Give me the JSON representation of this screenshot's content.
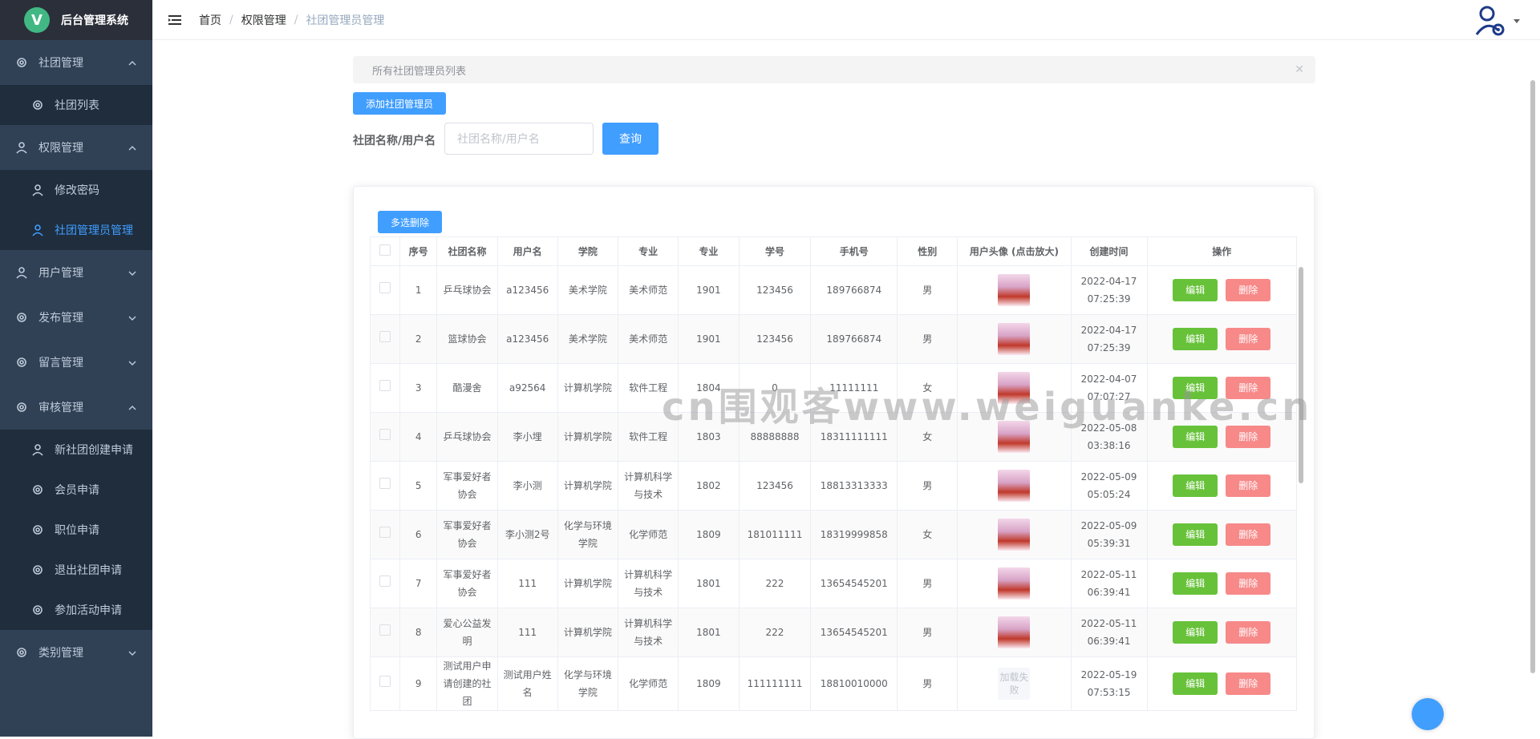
{
  "app": {
    "title": "后台管理系统",
    "logo_letter": "V"
  },
  "sidebar": {
    "groups": [
      {
        "label": "社团管理",
        "expanded": true,
        "items": [
          {
            "label": "社团列表"
          }
        ]
      },
      {
        "label": "权限管理",
        "expanded": true,
        "items": [
          {
            "label": "修改密码"
          },
          {
            "label": "社团管理员管理",
            "active": true
          }
        ]
      },
      {
        "label": "用户管理",
        "expanded": false,
        "items": []
      },
      {
        "label": "发布管理",
        "expanded": false,
        "items": []
      },
      {
        "label": "留言管理",
        "expanded": false,
        "items": []
      },
      {
        "label": "审核管理",
        "expanded": true,
        "items": [
          {
            "label": "新社团创建申请"
          },
          {
            "label": "会员申请"
          },
          {
            "label": "职位申请"
          },
          {
            "label": "退出社团申请"
          },
          {
            "label": "参加活动申请"
          }
        ]
      },
      {
        "label": "类别管理",
        "expanded": false,
        "items": []
      }
    ]
  },
  "breadcrumb": {
    "items": [
      "首页",
      "权限管理"
    ],
    "current": "社团管理员管理"
  },
  "alert": {
    "text": "所有社团管理员列表"
  },
  "toolbar": {
    "add_label": "添加社团管理员"
  },
  "search": {
    "label": "社团名称/用户名",
    "placeholder": "社团名称/用户名",
    "button_label": "查询"
  },
  "table": {
    "multi_delete_label": "多选删除",
    "columns": [
      "序号",
      "社团名称",
      "用户名",
      "学院",
      "专业",
      "专业",
      "学号",
      "手机号",
      "性别",
      "用户头像 (点击放大)",
      "创建时间",
      "操作"
    ],
    "edit_label": "编辑",
    "delete_label": "删除",
    "rows": [
      {
        "no": "1",
        "club": "乒乓球协会",
        "user": "a123456",
        "college": "美术学院",
        "major": "美术师范",
        "class": "1901",
        "sid": "123456",
        "phone": "189766874",
        "gender": "男",
        "avatar_failed": false,
        "created": "2022-04-17 07:25:39"
      },
      {
        "no": "2",
        "club": "篮球协会",
        "user": "a123456",
        "college": "美术学院",
        "major": "美术师范",
        "class": "1901",
        "sid": "123456",
        "phone": "189766874",
        "gender": "男",
        "avatar_failed": false,
        "created": "2022-04-17 07:25:39"
      },
      {
        "no": "3",
        "club": "酷漫舍",
        "user": "a92564",
        "college": "计算机学院",
        "major": "软件工程",
        "class": "1804",
        "sid": "0",
        "phone": "11111111",
        "gender": "女",
        "avatar_failed": false,
        "created": "2022-04-07 07:07:27"
      },
      {
        "no": "4",
        "club": "乒乓球协会",
        "user": "李小埋",
        "college": "计算机学院",
        "major": "软件工程",
        "class": "1803",
        "sid": "88888888",
        "phone": "18311111111",
        "gender": "女",
        "avatar_failed": false,
        "created": "2022-05-08 03:38:16"
      },
      {
        "no": "5",
        "club": "军事爱好者协会",
        "user": "李小测",
        "college": "计算机学院",
        "major": "计算机科学与技术",
        "class": "1802",
        "sid": "123456",
        "phone": "18813313333",
        "gender": "男",
        "avatar_failed": false,
        "created": "2022-05-09 05:05:24"
      },
      {
        "no": "6",
        "club": "军事爱好者协会",
        "user": "李小测2号",
        "college": "化学与环境学院",
        "major": "化学师范",
        "class": "1809",
        "sid": "181011111",
        "phone": "18319999858",
        "gender": "女",
        "avatar_failed": false,
        "created": "2022-05-09 05:39:31"
      },
      {
        "no": "7",
        "club": "军事爱好者协会",
        "user": "111",
        "college": "计算机学院",
        "major": "计算机科学与技术",
        "class": "1801",
        "sid": "222",
        "phone": "13654545201",
        "gender": "男",
        "avatar_failed": false,
        "created": "2022-05-11 06:39:41"
      },
      {
        "no": "8",
        "club": "爱心公益发明",
        "user": "111",
        "college": "计算机学院",
        "major": "计算机科学与技术",
        "class": "1801",
        "sid": "222",
        "phone": "13654545201",
        "gender": "男",
        "avatar_failed": false,
        "created": "2022-05-11 06:39:41"
      },
      {
        "no": "9",
        "club": "测试用户申请创建的社团",
        "user": "测试用户姓名",
        "college": "化学与环境学院",
        "major": "化学师范",
        "class": "1809",
        "sid": "111111111",
        "phone": "18810010000",
        "gender": "男",
        "avatar_failed": true,
        "created": "2022-05-19 07:53:15"
      }
    ],
    "avatar_fail_text": "加载失败"
  },
  "watermark": "cn围观客www.weiguanke.cn",
  "colors": {
    "sidebar_bg": "#304156",
    "sidebar_sub_bg": "#1f2d3d",
    "primary": "#409eff",
    "success": "#67c23a",
    "danger": "#f78989"
  }
}
